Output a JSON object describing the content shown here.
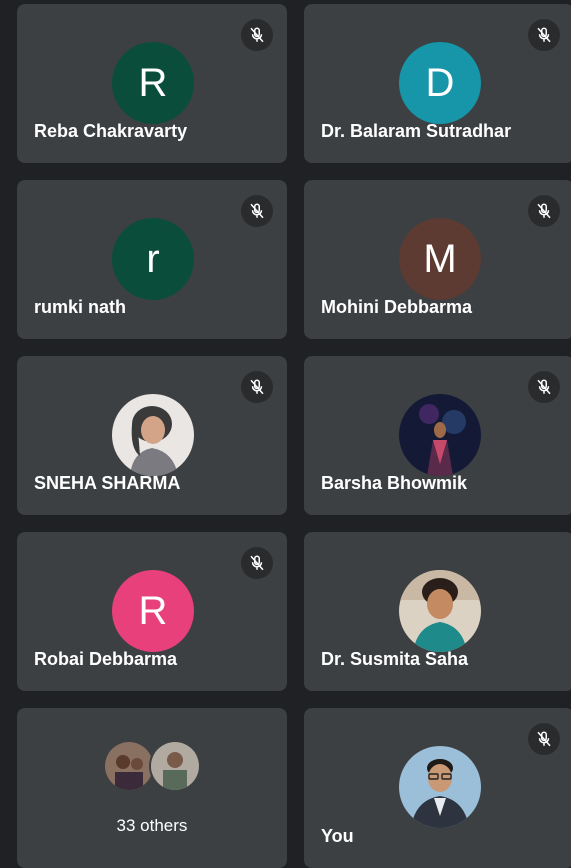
{
  "participants": [
    {
      "name": "Reba Chakravarty",
      "initial": "R",
      "avatar_color": "#0b4d3b",
      "muted": true
    },
    {
      "name": "Dr. Balaram Sutradhar",
      "initial": "D",
      "avatar_color": "#1696a8",
      "muted": true
    },
    {
      "name": "rumki nath",
      "initial": "r",
      "avatar_color": "#0b4d3b",
      "muted": true
    },
    {
      "name": "Mohini Debbarma",
      "initial": "M",
      "avatar_color": "#5d3a32",
      "muted": true
    },
    {
      "name": "SNEHA SHARMA",
      "avatar": "photo",
      "muted": true
    },
    {
      "name": "Barsha Bhowmik",
      "avatar": "photo",
      "muted": true
    },
    {
      "name": "Robai Debbarma",
      "initial": "R",
      "avatar_color": "#e8407a",
      "muted": true
    },
    {
      "name": "Dr. Susmita Saha",
      "avatar": "photo",
      "muted": false
    }
  ],
  "others": {
    "label": "33 others"
  },
  "self": {
    "label": "You",
    "avatar": "photo",
    "muted": true
  }
}
